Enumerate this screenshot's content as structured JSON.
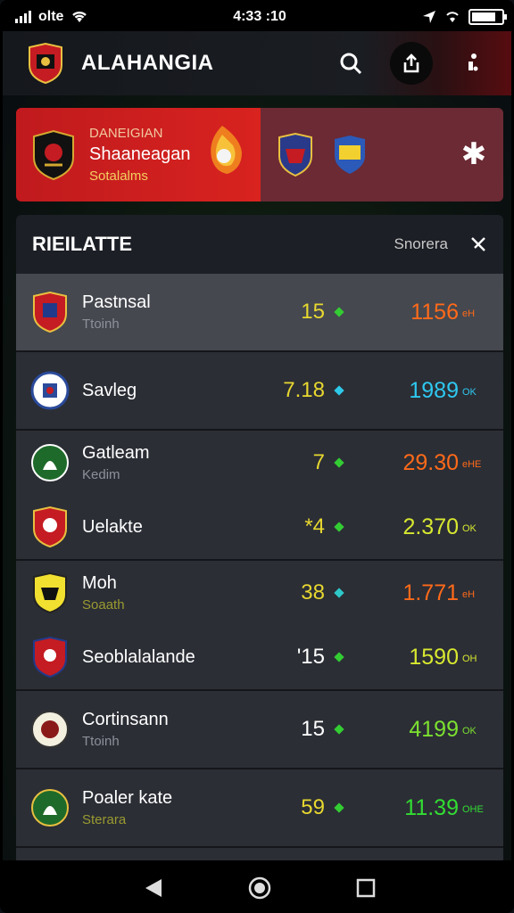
{
  "status": {
    "carrier": "olte",
    "time": "4:33 :10"
  },
  "header": {
    "app_title": "ALAHANGIA"
  },
  "banner": {
    "kicker": "DANEIGIAN",
    "title": "Shaaneagan",
    "subtitle": "Sotalalms"
  },
  "panel": {
    "title": "RIEILATTE",
    "sort_label": "Snorera"
  },
  "rows": [
    {
      "name": "Pastnsal",
      "sub": "Ttoinh",
      "value": "15",
      "score": "1156",
      "unit": "eH",
      "colors": {
        "value": "#e8d830",
        "dot": "#33cc33",
        "score": "#ff6a1a"
      }
    },
    {
      "name": "Savleg",
      "sub": "",
      "value": "7.18",
      "score": "1989",
      "unit": "OK",
      "colors": {
        "value": "#e8d830",
        "dot": "#2ec8e8",
        "score": "#2ec8f0"
      }
    },
    {
      "name": "Gatleam",
      "sub": "Kedim",
      "value": "7",
      "score": "29.30",
      "unit": "eHE",
      "colors": {
        "value": "#e8d830",
        "dot": "#33cc33",
        "score": "#ff6a1a"
      }
    },
    {
      "name": "Uelakte",
      "sub": "",
      "value": "*4",
      "score": "2.370",
      "unit": "OK",
      "colors": {
        "value": "#e8d830",
        "dot": "#33cc33",
        "score": "#d8e830"
      }
    },
    {
      "name": "Moh",
      "sub": "Soaath",
      "value": "38",
      "score": "1.771",
      "unit": "eH",
      "colors": {
        "value": "#e8d830",
        "dot": "#2ec8c8",
        "score": "#ff6a1a"
      }
    },
    {
      "name": "Seoblalalande",
      "sub": "",
      "value": "'15",
      "score": "1590",
      "unit": "OH",
      "colors": {
        "value": "#ffffff",
        "dot": "#33cc33",
        "score": "#d8e830"
      }
    },
    {
      "name": "Cortinsann",
      "sub": "Ttoinh",
      "value": "15",
      "score": "4199",
      "unit": "OK",
      "colors": {
        "value": "#ffffff",
        "dot": "#33cc33",
        "score": "#7ce030"
      }
    },
    {
      "name": "Poaler kate",
      "sub": "Sterara",
      "value": "59",
      "score": "11.39",
      "unit": "OHE",
      "colors": {
        "value": "#e8d830",
        "dot": "#33cc33",
        "score": "#33dd33"
      }
    }
  ],
  "icons": {
    "header": [
      "search-icon",
      "share-icon",
      "more-icon"
    ],
    "nav": [
      "back-icon",
      "home-icon",
      "recents-icon"
    ]
  }
}
